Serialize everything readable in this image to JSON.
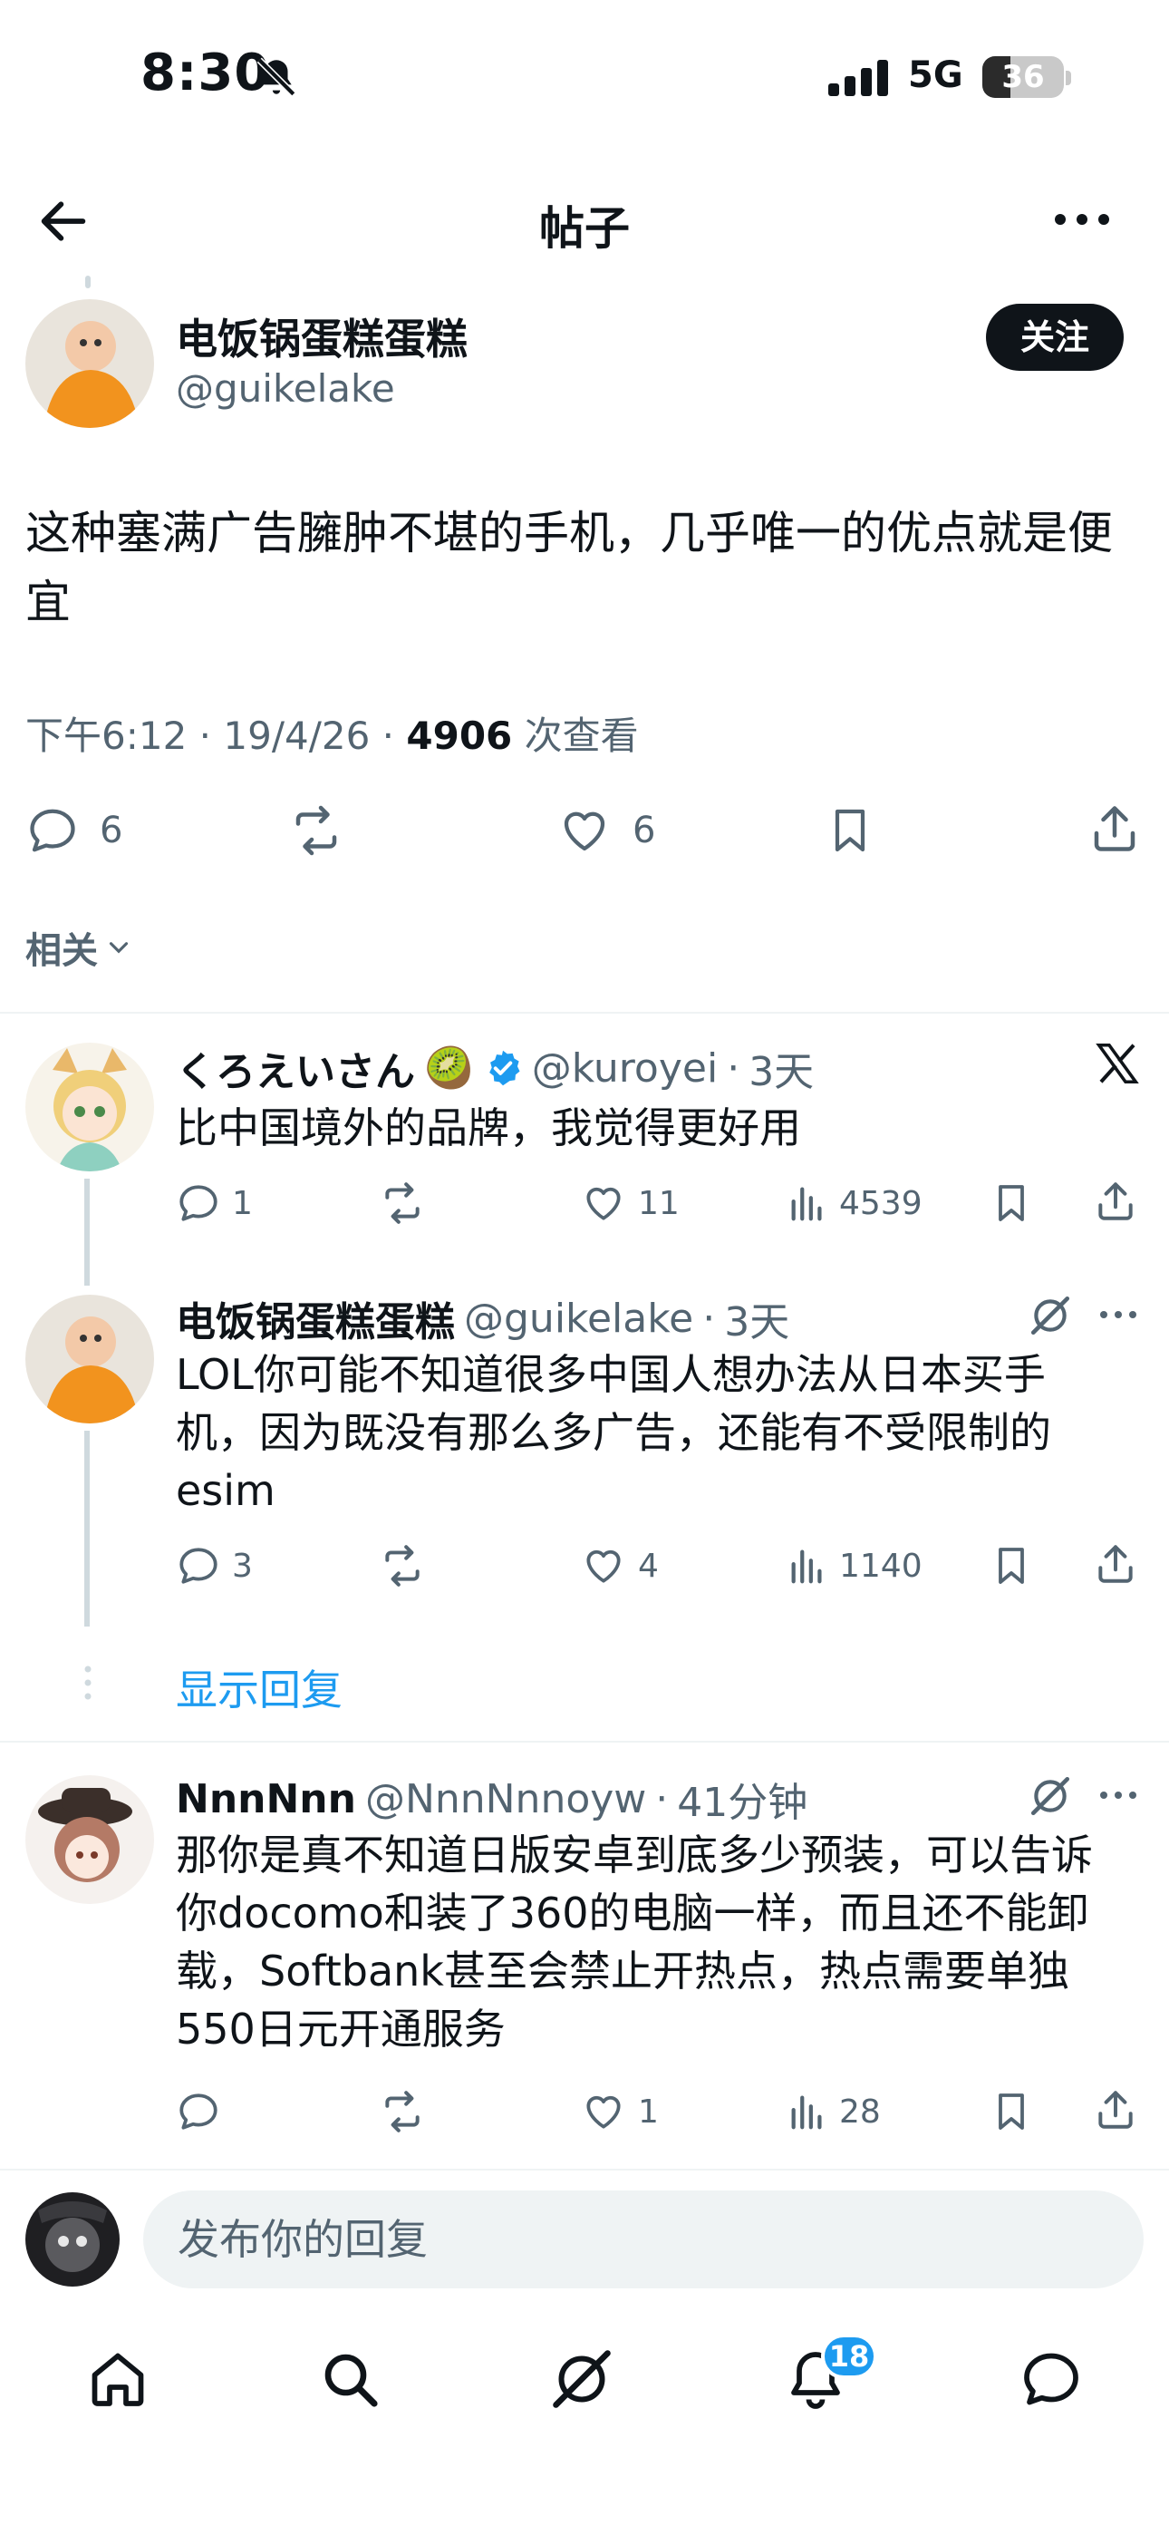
{
  "status_bar": {
    "time": "8:30",
    "network": "5G",
    "battery": "36"
  },
  "header": {
    "title": "帖子"
  },
  "post": {
    "author_name": "电饭锅蛋糕蛋糕",
    "author_handle": "@guikelake",
    "follow_label": "关注",
    "text": "这种塞满广告臃肿不堪的手机，几乎唯一的优点就是便宜",
    "time": "下午6:12",
    "date": "19/4/26",
    "views": "4906",
    "views_label": "次查看",
    "replies": "6",
    "likes": "6"
  },
  "related_label": "相关",
  "replies": [
    {
      "name": "くろえいさん",
      "emoji": "🥝",
      "handle": "@kuroyei",
      "age": "3天",
      "text": "比中国境外的品牌，我觉得更好用",
      "replies": "1",
      "retweets": "",
      "likes": "11",
      "views": "4539"
    },
    {
      "name": "电饭锅蛋糕蛋糕",
      "handle": "@guikelake",
      "age": "3天",
      "text": "LOL你可能不知道很多中国人想办法从日本买手机，因为既没有那么多广告，还能有不受限制的esim",
      "replies": "3",
      "likes": "4",
      "views": "1140"
    },
    {
      "name": "NnnNnn",
      "handle": "@NnnNnnoyw",
      "age": "41分钟",
      "text": "那你是真不知道日版安卓到底多少预装，可以告诉你docomo和装了360的电脑一样，而且还不能卸载，Softbank甚至会禁止开热点，热点需要单独550日元开通服务",
      "replies": "",
      "likes": "1",
      "views": "28"
    }
  ],
  "show_replies_label": "显示回复",
  "composer": {
    "placeholder": "发布你的回复"
  },
  "nav": {
    "notifications_badge": "18"
  },
  "colors": {
    "accent": "#1d9bf0",
    "text": "#0f1419",
    "muted": "#536471",
    "verified": "#1d9bf0"
  }
}
